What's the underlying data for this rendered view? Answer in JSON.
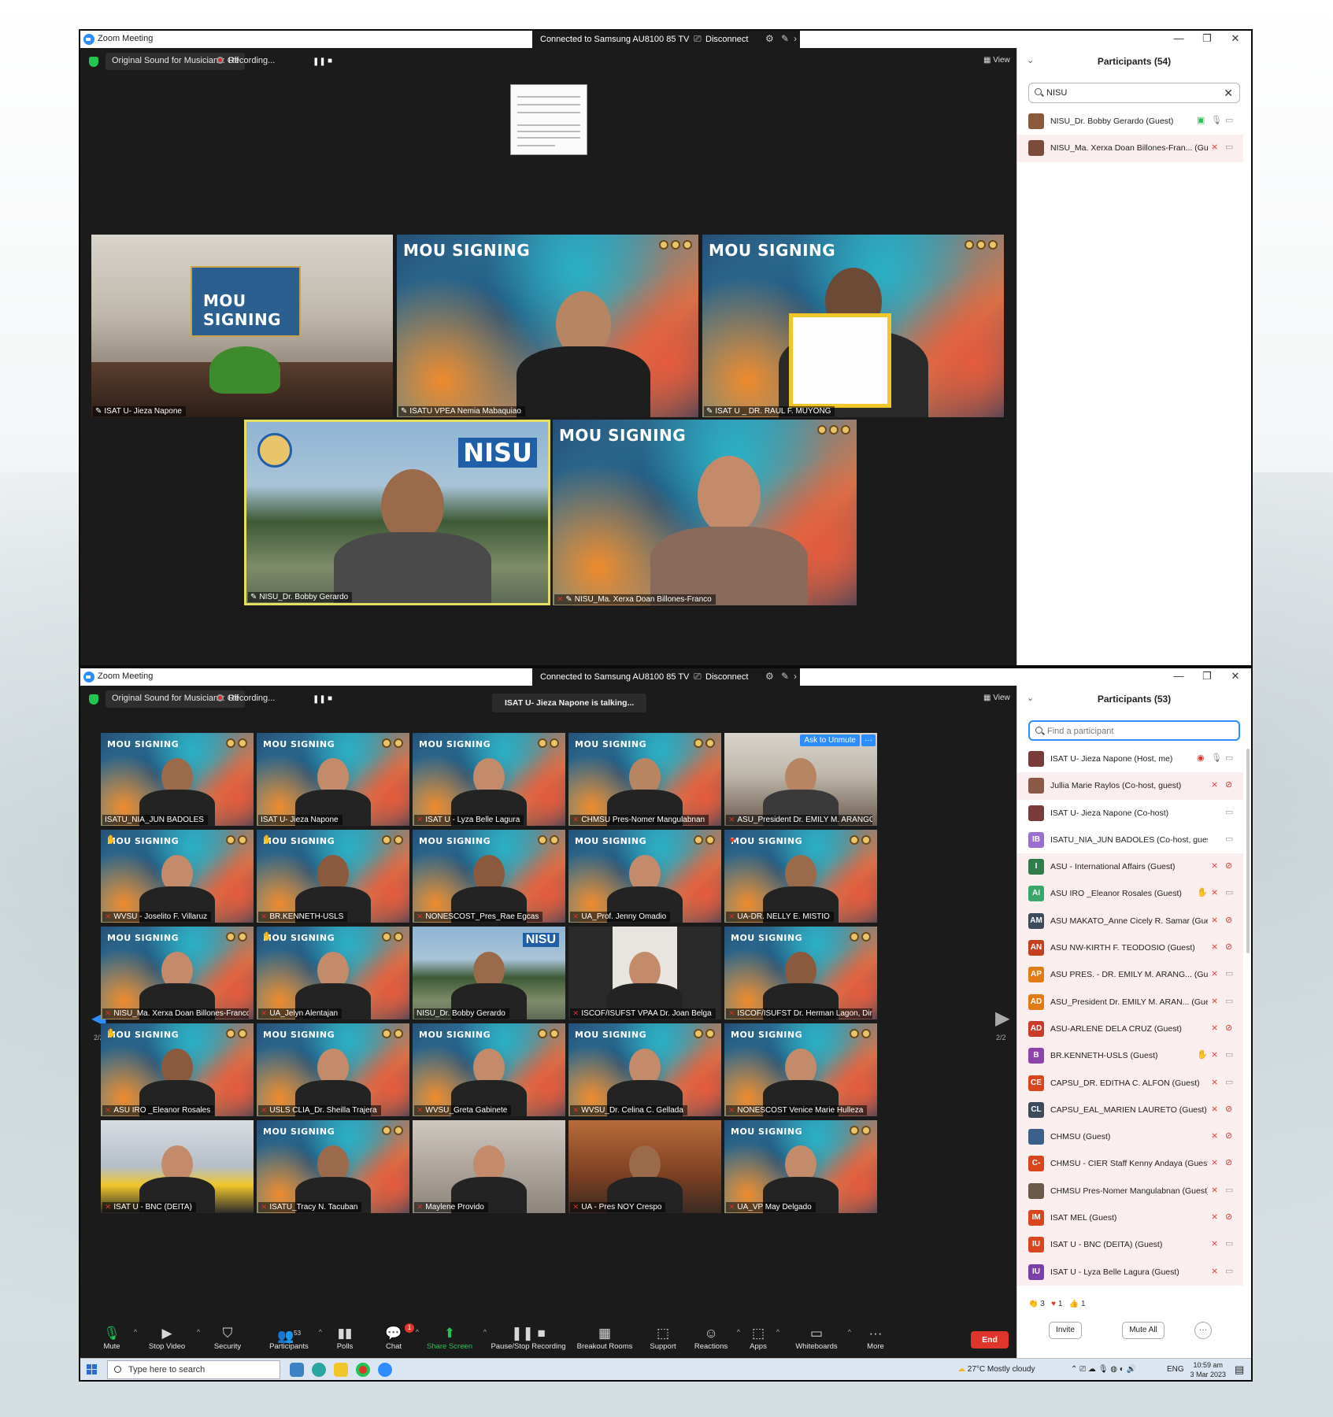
{
  "window1": {
    "title": "Zoom Meeting",
    "share_text": "Connected to Samsung AU8100 85 TV",
    "disconnect": "Disconnect",
    "original_sound": "Original Sound for Musicians: Off",
    "recording": "Recording...",
    "view": "View",
    "participants_title": "Participants (54)",
    "search_value": "NISU",
    "participants": [
      {
        "name": "NISU_Dr. Bobby Gerardo (Guest)",
        "avatar_color": "#8b5a3c"
      },
      {
        "name": "NISU_Ma. Xerxa Doan Billones-Fran... (Guest)",
        "avatar_color": "#7a4a3a"
      }
    ],
    "tiles": [
      {
        "label": "ISAT U- Jieza Napone"
      },
      {
        "label": "ISATU VPEA Nemia Mabaquiao"
      },
      {
        "label": "ISAT U _ DR. RAUL F. MUYONG"
      },
      {
        "label": "NISU_Dr. Bobby Gerardo"
      },
      {
        "label": "NISU_Ma. Xerxa Doan Billones-Franco"
      }
    ],
    "mou_text": "MOU SIGNING",
    "nisu_banner": "NISU"
  },
  "window2": {
    "title": "Zoom Meeting",
    "share_text": "Connected to Samsung AU8100 85 TV",
    "disconnect": "Disconnect",
    "original_sound": "Original Sound for Musicians: Off",
    "recording": "Recording...",
    "view": "View",
    "talking": "ISAT U- Jieza Napone is talking...",
    "participants_title": "Participants (53)",
    "search_placeholder": "Find a participant",
    "ask_to_unmute": "Ask to Unmute",
    "page_left": "2/2",
    "page_right": "2/2",
    "mou_text": "MOU SIGNING",
    "nisu_banner": "NISU",
    "participants": [
      {
        "initials": "",
        "name": "ISAT U- Jieza Napone (Host, me)",
        "color": "#7a3b3b"
      },
      {
        "initials": "",
        "name": "Jullia Marie Raylos (Co-host, guest)",
        "color": "#8a5a46"
      },
      {
        "initials": "",
        "name": "ISAT U- Jieza Napone (Co-host)",
        "color": "#7a3b3b"
      },
      {
        "initials": "IB",
        "name": "ISATU_NIA_JUN BADOLES (Co-host, guest)",
        "color": "#9b6fd0"
      },
      {
        "initials": "I",
        "name": "ASU - International Affairs (Guest)",
        "color": "#2f7d4b"
      },
      {
        "initials": "AI",
        "name": "ASU IRO _Eleanor Rosales (Guest)",
        "color": "#3aa66b"
      },
      {
        "initials": "AM",
        "name": "ASU MAKATO_Anne Cicely R. Samar (Guest)",
        "color": "#3b4b5c"
      },
      {
        "initials": "AN",
        "name": "ASU NW-KIRTH F. TEODOSIO (Guest)",
        "color": "#c4411f"
      },
      {
        "initials": "AP",
        "name": "ASU PRES. - DR. EMILY M. ARANG... (Guest)",
        "color": "#e07b16"
      },
      {
        "initials": "AD",
        "name": "ASU_President Dr. EMILY M. ARAN... (Guest)",
        "color": "#e07b16"
      },
      {
        "initials": "AD",
        "name": "ASU-ARLENE DELA CRUZ (Guest)",
        "color": "#c93a2b"
      },
      {
        "initials": "B",
        "name": "BR.KENNETH-USLS (Guest)",
        "color": "#8e44ad"
      },
      {
        "initials": "CE",
        "name": "CAPSU_DR. EDITHA C. ALFON (Guest)",
        "color": "#d9451c"
      },
      {
        "initials": "CL",
        "name": "CAPSU_EAL_MARIEN LAURETO (Guest)",
        "color": "#3b4b5c"
      },
      {
        "initials": "",
        "name": "CHMSU (Guest)",
        "color": "#3a5f8a"
      },
      {
        "initials": "C-",
        "name": "CHMSU - CIER Staff Kenny Andaya (Guest)",
        "color": "#d9451c"
      },
      {
        "initials": "",
        "name": "CHMSU Pres-Nomer Mangulabnan (Guest)",
        "color": "#6b5a4a"
      },
      {
        "initials": "IM",
        "name": "ISAT MEL (Guest)",
        "color": "#d9451c"
      },
      {
        "initials": "IU",
        "name": "ISAT U - BNC (DEITA) (Guest)",
        "color": "#d9451c"
      },
      {
        "initials": "IU",
        "name": "ISAT U - Lyza Belle Lagura (Guest)",
        "color": "#7b3fa8"
      }
    ],
    "reactions": [
      {
        "icon": "clap-icon",
        "glyph": "👏",
        "count": "3"
      },
      {
        "icon": "heart-icon",
        "glyph": "♥",
        "count": "1"
      },
      {
        "icon": "thumbs-up-icon",
        "glyph": "👍",
        "count": "1"
      }
    ],
    "invite": "Invite",
    "mute_all": "Mute All",
    "more_dots": "···",
    "grid": [
      {
        "label": "ISATU_NIA_JUN BADOLES",
        "bg": "mou",
        "muted": false
      },
      {
        "label": "ISAT U- Jieza Napone",
        "bg": "mou",
        "muted": false
      },
      {
        "label": "ISAT U - Lyza Belle Lagura",
        "bg": "mou",
        "muted": true
      },
      {
        "label": "CHMSU Pres-Nomer Mangulabnan",
        "bg": "mou",
        "muted": true
      },
      {
        "label": "ASU_President Dr. EMILY M. ARANGOTE",
        "bg": "office",
        "muted": true
      },
      {
        "label": "WVSU - Joselito F. Villaruz",
        "bg": "mou",
        "muted": true
      },
      {
        "label": "BR.KENNETH-USLS",
        "bg": "mou",
        "muted": true
      },
      {
        "label": "NONESCOST_Pres_Rae Egcas",
        "bg": "mou",
        "muted": true
      },
      {
        "label": "UA_Prof. Jenny Omadio",
        "bg": "mou",
        "muted": true
      },
      {
        "label": "UA-DR. NELLY E. MISTIO",
        "bg": "mou",
        "muted": true
      },
      {
        "label": "NISU_Ma. Xerxa Doan Billones-Franco",
        "bg": "mou",
        "muted": true
      },
      {
        "label": "UA_Jelyn Alentajan",
        "bg": "mou",
        "muted": true
      },
      {
        "label": "NISU_Dr. Bobby Gerardo",
        "bg": "nisu",
        "muted": false
      },
      {
        "label": "ISCOF/ISUFST VPAA Dr. Joan Belga",
        "bg": "dark",
        "muted": true
      },
      {
        "label": "ISCOF/ISUFST Dr. Herman Lagon, Director ...",
        "bg": "mou",
        "muted": true
      },
      {
        "label": "ASU IRO _Eleanor Rosales",
        "bg": "mou",
        "muted": true
      },
      {
        "label": "USLS CLIA_Dr. Sheilla Trajera",
        "bg": "mou",
        "muted": true
      },
      {
        "label": "WVSU_Greta Gabinete",
        "bg": "mou",
        "muted": true
      },
      {
        "label": "WVSU_Dr. Celina C. Gellada",
        "bg": "mou",
        "muted": true
      },
      {
        "label": "NONESCOST Venice Marie Hulleza",
        "bg": "mou",
        "muted": true
      },
      {
        "label": "ISAT U - BNC (DEITA)",
        "bg": "bldg",
        "muted": true
      },
      {
        "label": "ISATU_Tracy N. Tacuban",
        "bg": "mou",
        "muted": true
      },
      {
        "label": "Maylene Provido",
        "bg": "plain",
        "muted": true
      },
      {
        "label": "UA - Pres NOY Crespo",
        "bg": "room",
        "muted": true
      },
      {
        "label": "UA_VP May Delgado",
        "bg": "mou",
        "muted": true
      }
    ],
    "toolbar": {
      "mute": "Mute",
      "stop_video": "Stop Video",
      "security": "Security",
      "participants": "Participants",
      "participants_count": "53",
      "polls": "Polls",
      "chat": "Chat",
      "chat_badge": "1",
      "share_screen": "Share Screen",
      "pause_stop_recording": "Pause/Stop Recording",
      "breakout_rooms": "Breakout Rooms",
      "support": "Support",
      "reactions": "Reactions",
      "apps": "Apps",
      "whiteboards": "Whiteboards",
      "more": "More",
      "end": "End"
    }
  },
  "taskbar": {
    "search_placeholder": "Type here to search",
    "weather": "27°C  Mostly cloudy",
    "language": "ENG",
    "time": "10:59 am",
    "date": "3 Mar 2023"
  }
}
